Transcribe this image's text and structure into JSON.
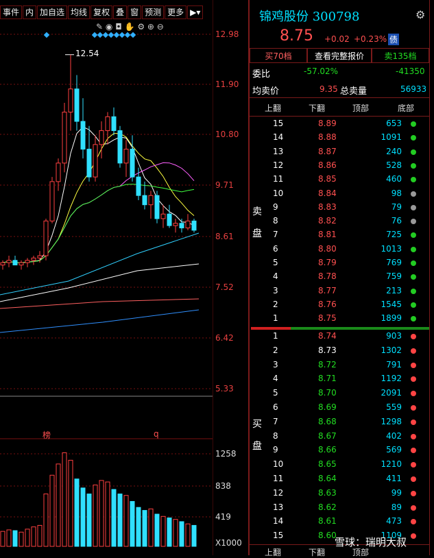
{
  "toolbar": {
    "items": [
      "事件",
      "内",
      "加自选",
      "均线",
      "复权",
      "叠",
      "窗",
      "预测",
      "更多"
    ]
  },
  "chart": {
    "price_axis": [
      "12.98",
      "11.90",
      "10.80",
      "9.71",
      "8.61",
      "7.52",
      "6.42",
      "5.33"
    ],
    "vol_axis": [
      "1258",
      "838",
      "419",
      "X1000"
    ],
    "high_label": "12.54",
    "markers": [
      "榜",
      "q"
    ]
  },
  "chart_data": {
    "type": "candlestick",
    "y_range": [
      5.33,
      12.98
    ],
    "candles": [
      [
        8.0,
        8.1,
        7.9,
        8.05
      ],
      [
        8.05,
        8.2,
        7.95,
        8.1
      ],
      [
        8.1,
        8.2,
        8.0,
        8.0
      ],
      [
        8.0,
        8.1,
        7.9,
        8.05
      ],
      [
        8.05,
        8.15,
        7.95,
        8.1
      ],
      [
        8.1,
        8.2,
        8.0,
        8.15
      ],
      [
        8.15,
        8.3,
        8.05,
        8.2
      ],
      [
        8.2,
        9.0,
        8.1,
        8.95
      ],
      [
        8.95,
        9.9,
        8.9,
        9.8
      ],
      [
        9.8,
        10.3,
        9.6,
        10.2
      ],
      [
        10.2,
        11.5,
        10.0,
        11.3
      ],
      [
        11.3,
        12.54,
        10.9,
        11.8
      ],
      [
        11.8,
        12.1,
        10.9,
        11.1
      ],
      [
        11.1,
        11.6,
        10.3,
        10.5
      ],
      [
        10.5,
        11.0,
        9.8,
        9.9
      ],
      [
        9.9,
        10.8,
        9.8,
        10.6
      ],
      [
        10.6,
        11.1,
        10.3,
        10.9
      ],
      [
        10.9,
        11.3,
        10.6,
        11.2
      ],
      [
        11.2,
        11.4,
        10.8,
        10.9
      ],
      [
        10.9,
        11.0,
        10.1,
        10.2
      ],
      [
        10.2,
        10.7,
        9.9,
        10.5
      ],
      [
        10.5,
        10.8,
        9.8,
        9.9
      ],
      [
        9.9,
        10.1,
        9.4,
        9.5
      ],
      [
        9.5,
        9.8,
        9.2,
        9.3
      ],
      [
        9.3,
        9.6,
        9.0,
        9.5
      ],
      [
        9.5,
        9.6,
        8.9,
        9.0
      ],
      [
        9.0,
        9.3,
        8.8,
        9.1
      ],
      [
        9.1,
        9.3,
        8.8,
        8.85
      ],
      [
        8.85,
        9.0,
        8.7,
        8.9
      ],
      [
        8.9,
        9.0,
        8.7,
        8.8
      ],
      [
        8.8,
        9.1,
        8.75,
        8.95
      ],
      [
        8.95,
        9.0,
        8.7,
        8.75
      ]
    ],
    "volumes": [
      200,
      220,
      210,
      190,
      230,
      260,
      280,
      700,
      950,
      1100,
      1250,
      1150,
      900,
      780,
      700,
      820,
      880,
      860,
      760,
      700,
      680,
      600,
      520,
      480,
      500,
      430,
      400,
      380,
      360,
      330,
      300,
      280
    ]
  },
  "header": {
    "title": "锦鸡股份 300798",
    "price": "8.75",
    "change": "+0.02",
    "change_pct": "+0.23%",
    "debt_badge": "债",
    "buttons": [
      "买70档",
      "查看完整报价",
      "卖135档"
    ],
    "weibi_label": "委比",
    "weibi_pct": "-57.02%",
    "weibi_val": "-41350",
    "avg_label": "均卖价",
    "avg_val": "9.35",
    "total_label": "总卖量",
    "total_val": "56933",
    "cols": [
      "上翻",
      "下翻",
      "顶部",
      "底部"
    ]
  },
  "sell_side_label": [
    "卖",
    "盘"
  ],
  "buy_side_label": [
    "买",
    "盘"
  ],
  "asks": [
    {
      "lv": "15",
      "price": "8.89",
      "vol": "653",
      "dot": "#22cc22"
    },
    {
      "lv": "14",
      "price": "8.88",
      "vol": "1091",
      "dot": "#22cc22"
    },
    {
      "lv": "13",
      "price": "8.87",
      "vol": "240",
      "dot": "#22cc22"
    },
    {
      "lv": "12",
      "price": "8.86",
      "vol": "528",
      "dot": "#22cc22"
    },
    {
      "lv": "11",
      "price": "8.85",
      "vol": "460",
      "dot": "#22cc22"
    },
    {
      "lv": "10",
      "price": "8.84",
      "vol": "98",
      "dot": "#999999"
    },
    {
      "lv": "9",
      "price": "8.83",
      "vol": "79",
      "dot": "#999999"
    },
    {
      "lv": "8",
      "price": "8.82",
      "vol": "76",
      "dot": "#999999"
    },
    {
      "lv": "7",
      "price": "8.81",
      "vol": "725",
      "dot": "#22cc22"
    },
    {
      "lv": "6",
      "price": "8.80",
      "vol": "1013",
      "dot": "#22cc22"
    },
    {
      "lv": "5",
      "price": "8.79",
      "vol": "769",
      "dot": "#22cc22"
    },
    {
      "lv": "4",
      "price": "8.78",
      "vol": "759",
      "dot": "#22cc22"
    },
    {
      "lv": "3",
      "price": "8.77",
      "vol": "213",
      "dot": "#22cc22"
    },
    {
      "lv": "2",
      "price": "8.76",
      "vol": "1545",
      "dot": "#22cc22"
    },
    {
      "lv": "1",
      "price": "8.75",
      "vol": "1899",
      "dot": "#22cc22"
    }
  ],
  "bids": [
    {
      "lv": "1",
      "price": "8.74",
      "vol": "903",
      "color": "#ff5050",
      "dot": "#ff4444"
    },
    {
      "lv": "2",
      "price": "8.73",
      "vol": "1302",
      "color": "#ffffff",
      "dot": "#ff4444"
    },
    {
      "lv": "3",
      "price": "8.72",
      "vol": "791",
      "color": "#22dd22",
      "dot": "#ff4444"
    },
    {
      "lv": "4",
      "price": "8.71",
      "vol": "1192",
      "color": "#22dd22",
      "dot": "#ff4444"
    },
    {
      "lv": "5",
      "price": "8.70",
      "vol": "2091",
      "color": "#22dd22",
      "dot": "#ff4444"
    },
    {
      "lv": "6",
      "price": "8.69",
      "vol": "559",
      "color": "#22dd22",
      "dot": "#ff4444"
    },
    {
      "lv": "7",
      "price": "8.68",
      "vol": "1298",
      "color": "#22dd22",
      "dot": "#ff4444"
    },
    {
      "lv": "8",
      "price": "8.67",
      "vol": "402",
      "color": "#22dd22",
      "dot": "#ff4444"
    },
    {
      "lv": "9",
      "price": "8.66",
      "vol": "569",
      "color": "#22dd22",
      "dot": "#ff4444"
    },
    {
      "lv": "10",
      "price": "8.65",
      "vol": "1210",
      "color": "#22dd22",
      "dot": "#ff4444"
    },
    {
      "lv": "11",
      "price": "8.64",
      "vol": "411",
      "color": "#22dd22",
      "dot": "#ff4444"
    },
    {
      "lv": "12",
      "price": "8.63",
      "vol": "99",
      "color": "#22dd22",
      "dot": "#ff4444"
    },
    {
      "lv": "13",
      "price": "8.62",
      "vol": "89",
      "color": "#22dd22",
      "dot": "#ff4444"
    },
    {
      "lv": "14",
      "price": "8.61",
      "vol": "473",
      "color": "#22dd22",
      "dot": "#ff4444"
    },
    {
      "lv": "15",
      "price": "8.60",
      "vol": "1109",
      "color": "#22dd22",
      "dot": "#ff4444"
    }
  ],
  "footer_cols": [
    "上翻",
    "下翻",
    "顶部"
  ],
  "watermark": "雪球：瑞明大叔"
}
